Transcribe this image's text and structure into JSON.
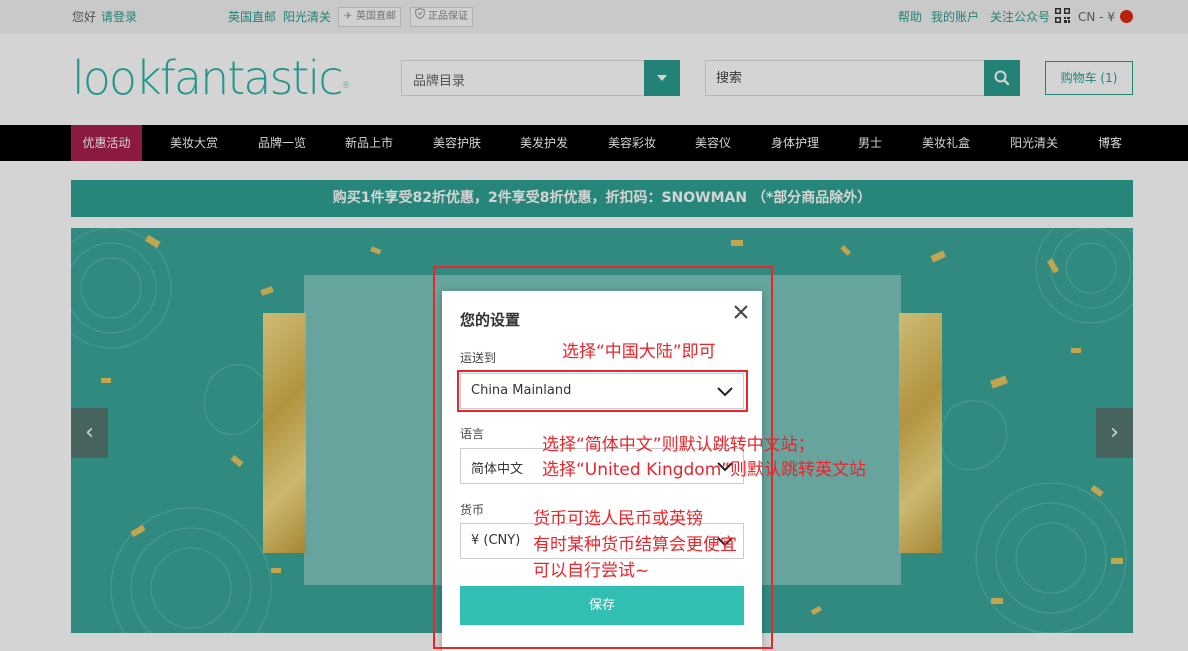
{
  "topbar": {
    "greeting": "您好",
    "login": "请登录",
    "uk_direct": "英国直邮",
    "sunshine": "阳光清关",
    "badge_uk": "英国直邮",
    "badge_genuine": "正品保证",
    "help": "帮助",
    "account": "我的账户",
    "follow": "关注公众号",
    "locale": "CN - ¥"
  },
  "header": {
    "logo": "lookfantastic",
    "brand_placeholder": "品牌目录",
    "search_placeholder": "搜索",
    "cart_label": "购物车 (1)"
  },
  "nav": {
    "items": [
      "优惠活动",
      "美妆大赏",
      "品牌一览",
      "新品上市",
      "美容护肤",
      "美发护发",
      "美容彩妆",
      "美容仪",
      "身体护理",
      "男士",
      "美妆礼盒",
      "阳光清关",
      "博客"
    ]
  },
  "promo": {
    "text": "购买1件享受82折优惠，2件享受8折优惠，折扣码：SNOWMAN （*部分商品除外）"
  },
  "banner": {
    "arrow_left": "‹",
    "arrow_right": "›"
  },
  "modal": {
    "title": "您的设置",
    "ship_label": "运送到",
    "ship_value": "China Mainland",
    "lang_label": "语言",
    "lang_value": "简体中文",
    "currency_label": "货币",
    "currency_value": "¥ (CNY)",
    "save_label": "保存"
  },
  "annotations": {
    "ship_note": "选择“中国大陆”即可",
    "lang_note_1": "选择“简体中文”则默认跳转中文站；",
    "lang_note_2": "选择“United Kingdom”则默认跳转英文站",
    "currency_note_1": "货币可选人民币或英镑",
    "currency_note_2": "有时某种货币结算会更便宜",
    "currency_note_3": "可以自行尝试~"
  },
  "colors": {
    "accent": "#2a9d8f",
    "active_nav": "#a81f4e",
    "annotation": "#e8262b",
    "save": "#31beb3"
  }
}
